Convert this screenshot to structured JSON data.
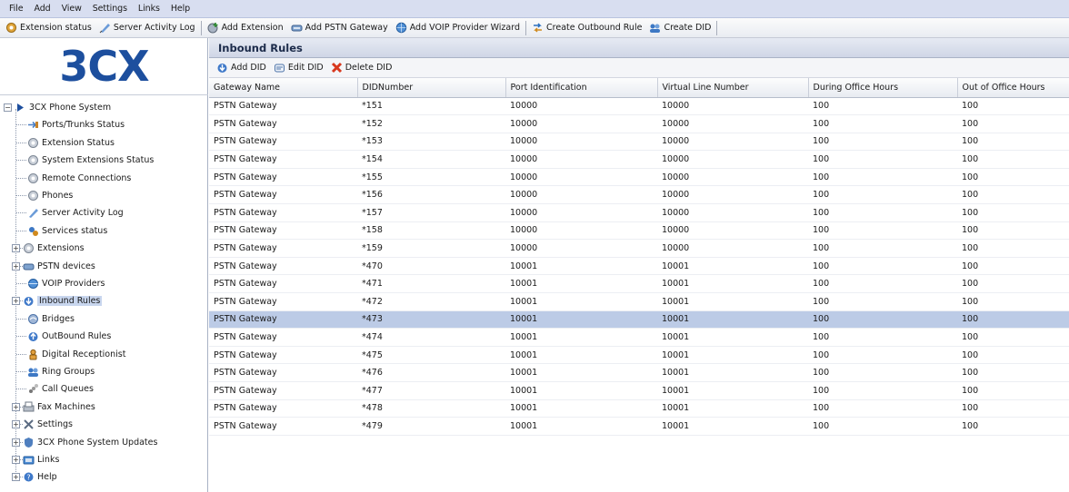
{
  "menu": [
    "File",
    "Add",
    "View",
    "Settings",
    "Links",
    "Help"
  ],
  "toolbar": [
    {
      "label": "Extension status",
      "icon": "extension-status-icon"
    },
    {
      "label": "Server Activity Log",
      "icon": "activity-log-icon"
    },
    {
      "label": "Add Extension",
      "icon": "add-extension-icon"
    },
    {
      "label": "Add PSTN Gateway",
      "icon": "pstn-gateway-icon"
    },
    {
      "label": "Add VOIP Provider Wizard",
      "icon": "voip-provider-icon"
    },
    {
      "label": "Create Outbound Rule",
      "icon": "outbound-rule-icon"
    },
    {
      "label": "Create DID",
      "icon": "create-did-icon"
    }
  ],
  "logo": "3CX",
  "tree": [
    {
      "label": "3CX Phone System",
      "icon": "root-arrow-icon",
      "expander": "−"
    },
    {
      "label": "Ports/Trunks Status",
      "icon": "ports-icon"
    },
    {
      "label": "Extension Status",
      "icon": "extension-status-icon"
    },
    {
      "label": "System Extensions Status",
      "icon": "system-extension-icon"
    },
    {
      "label": "Remote Connections",
      "icon": "remote-icon"
    },
    {
      "label": "Phones",
      "icon": "phone-icon"
    },
    {
      "label": "Server Activity Log",
      "icon": "activity-log-icon"
    },
    {
      "label": "Services status",
      "icon": "services-icon"
    },
    {
      "label": "Extensions",
      "icon": "extensions-icon",
      "expander": "+"
    },
    {
      "label": "PSTN devices",
      "icon": "pstn-device-icon",
      "expander": "+"
    },
    {
      "label": "VOIP Providers",
      "icon": "voip-provider-icon"
    },
    {
      "label": "Inbound Rules",
      "icon": "inbound-rule-icon",
      "expander": "+"
    },
    {
      "label": "Bridges",
      "icon": "bridge-icon"
    },
    {
      "label": "OutBound Rules",
      "icon": "outbound-rule-icon"
    },
    {
      "label": "Digital Receptionist",
      "icon": "receptionist-icon"
    },
    {
      "label": "Ring Groups",
      "icon": "ring-group-icon"
    },
    {
      "label": "Call Queues",
      "icon": "call-queue-icon"
    },
    {
      "label": "Fax Machines",
      "icon": "fax-icon",
      "expander": "+"
    },
    {
      "label": "Settings",
      "icon": "settings-icon",
      "expander": "+"
    },
    {
      "label": "3CX Phone System Updates",
      "icon": "updates-icon",
      "expander": "+"
    },
    {
      "label": "Links",
      "icon": "links-icon",
      "expander": "+"
    },
    {
      "label": "Help",
      "icon": "help-icon",
      "expander": "+"
    }
  ],
  "panel": {
    "title": "Inbound Rules",
    "actions": [
      {
        "label": "Add DID",
        "icon": "add-did-icon"
      },
      {
        "label": "Edit DID",
        "icon": "edit-did-icon"
      },
      {
        "label": "Delete DID",
        "icon": "delete-did-icon"
      }
    ]
  },
  "table": {
    "columns": [
      "Gateway Name",
      "DIDNumber",
      "Port Identification",
      "Virtual Line Number",
      "During Office Hours",
      "Out of Office Hours"
    ],
    "rows": [
      [
        "PSTN Gateway",
        "*151",
        "10000",
        "10000",
        "100",
        "100"
      ],
      [
        "PSTN Gateway",
        "*152",
        "10000",
        "10000",
        "100",
        "100"
      ],
      [
        "PSTN Gateway",
        "*153",
        "10000",
        "10000",
        "100",
        "100"
      ],
      [
        "PSTN Gateway",
        "*154",
        "10000",
        "10000",
        "100",
        "100"
      ],
      [
        "PSTN Gateway",
        "*155",
        "10000",
        "10000",
        "100",
        "100"
      ],
      [
        "PSTN Gateway",
        "*156",
        "10000",
        "10000",
        "100",
        "100"
      ],
      [
        "PSTN Gateway",
        "*157",
        "10000",
        "10000",
        "100",
        "100"
      ],
      [
        "PSTN Gateway",
        "*158",
        "10000",
        "10000",
        "100",
        "100"
      ],
      [
        "PSTN Gateway",
        "*159",
        "10000",
        "10000",
        "100",
        "100"
      ],
      [
        "PSTN Gateway",
        "*470",
        "10001",
        "10001",
        "100",
        "100"
      ],
      [
        "PSTN Gateway",
        "*471",
        "10001",
        "10001",
        "100",
        "100"
      ],
      [
        "PSTN Gateway",
        "*472",
        "10001",
        "10001",
        "100",
        "100"
      ],
      [
        "PSTN Gateway",
        "*473",
        "10001",
        "10001",
        "100",
        "100"
      ],
      [
        "PSTN Gateway",
        "*474",
        "10001",
        "10001",
        "100",
        "100"
      ],
      [
        "PSTN Gateway",
        "*475",
        "10001",
        "10001",
        "100",
        "100"
      ],
      [
        "PSTN Gateway",
        "*476",
        "10001",
        "10001",
        "100",
        "100"
      ],
      [
        "PSTN Gateway",
        "*477",
        "10001",
        "10001",
        "100",
        "100"
      ],
      [
        "PSTN Gateway",
        "*478",
        "10001",
        "10001",
        "100",
        "100"
      ],
      [
        "PSTN Gateway",
        "*479",
        "10001",
        "10001",
        "100",
        "100"
      ]
    ],
    "selected_row": 12
  },
  "colors": {
    "accent": "#1d4f9e",
    "selection": "#bccbe6",
    "menubar": "#d8def0"
  }
}
